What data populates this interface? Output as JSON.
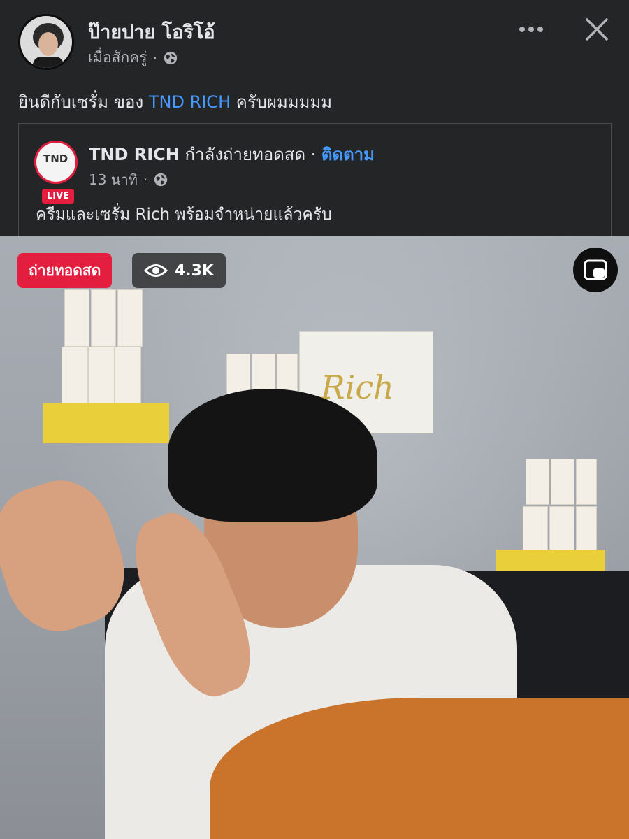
{
  "post": {
    "author": "ป๊ายปาย โอริโอ้",
    "time": "เมื่อสักครู่",
    "dot": "·",
    "text_prefix": "ยินดีกับเซรั่ม ของ ",
    "text_link": "TND RICH",
    "text_suffix": " ครับผมมมมม"
  },
  "shared": {
    "page_name": "TND RICH",
    "status": " กำลังถ่ายทอดสด · ",
    "follow": "ติดตาม",
    "time": "13 นาที",
    "dot": "·",
    "text": "ครีมและเซรั่ม Rich พร้อมจำหน่ายแล้วครับ",
    "logo_text": "TND",
    "live_tag": "LIVE"
  },
  "video": {
    "live_label": "ถ่ายทอดสด",
    "viewers": "4.3K",
    "poster_text": "Rich"
  },
  "icons": {
    "more": "more-dots-icon",
    "close": "close-icon",
    "globe": "globe-icon",
    "eye": "eye-icon",
    "pip": "picture-in-picture-icon"
  },
  "colors": {
    "live_red": "#e41e3f",
    "link_blue": "#4599ff",
    "background": "#242526"
  }
}
